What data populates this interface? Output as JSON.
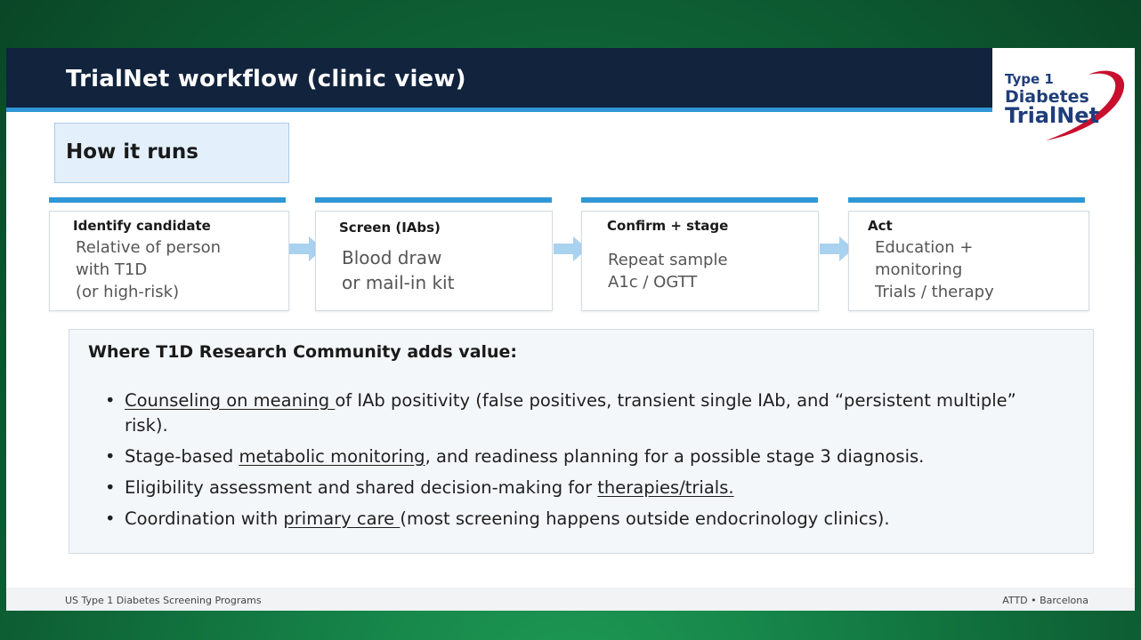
{
  "header": {
    "title": "TrialNet workflow (clinic view)"
  },
  "logo": {
    "line1": "Type 1",
    "line2": "Diabetes",
    "line3": "TrialNet"
  },
  "section": {
    "label": "How it runs"
  },
  "steps": [
    {
      "title": "Identify candidate",
      "lines": [
        "Relative of person",
        "with T1D",
        "(or high-risk)"
      ]
    },
    {
      "title": "Screen (IAbs)",
      "lines": [
        "Blood draw",
        "or mail-in kit"
      ]
    },
    {
      "title": "Confirm + stage",
      "lines": [
        "Repeat sample",
        "A1c / OGTT"
      ]
    },
    {
      "title": "Act",
      "lines": [
        "Education +",
        "monitoring",
        "Trials / therapy"
      ]
    }
  ],
  "value": {
    "heading": "Where T1D Research Community adds value:",
    "bullet_glyph": "•",
    "items": [
      {
        "u": "Counseling on meaning ",
        "rest": "of IAb positivity (false positives, transient single IAb, and “persistent multiple” risk)."
      },
      {
        "pre": "Stage-based ",
        "u": "metabolic monitoring",
        "rest": ", and readiness planning for a possible stage 3 diagnosis."
      },
      {
        "pre": "Eligibility assessment and shared decision-making for ",
        "u": "therapies/trials."
      },
      {
        "pre": "Coordination with ",
        "u": "primary care ",
        "rest": "(most screening happens outside endocrinology clinics)."
      }
    ]
  },
  "footer": {
    "left": "US Type 1 Diabetes Screening Programs",
    "right": "ATTD • Barcelona"
  },
  "colors": {
    "header_bg": "#12233d",
    "accent": "#2f97d6",
    "arrow": "#a9d2f0"
  }
}
